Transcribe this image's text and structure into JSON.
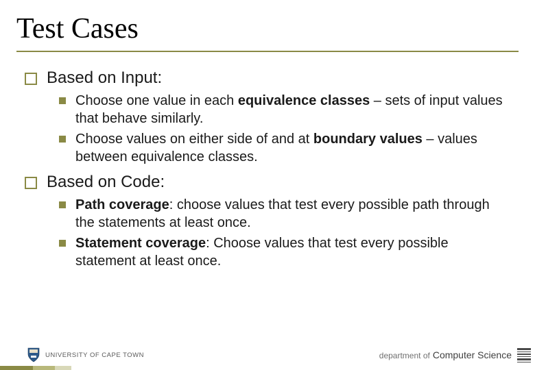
{
  "title": "Test Cases",
  "sections": [
    {
      "heading": "Based on Input:",
      "items": [
        {
          "pre": "Choose one value in each ",
          "bold": "equivalence classes",
          "post": " – sets of input values that behave similarly."
        },
        {
          "pre": "Choose values on either side of and at ",
          "bold": "boundary values",
          "post": " – values between equivalence classes."
        }
      ]
    },
    {
      "heading": "Based on Code:",
      "items": [
        {
          "boldlead": "Path coverage",
          "rest": ": choose values that test every possible path through the statements at least once."
        },
        {
          "boldlead": "Statement coverage",
          "rest": ": Choose values that test every possible statement at least once."
        }
      ]
    }
  ],
  "footer": {
    "university": "UNIVERSITY OF CAPE TOWN",
    "dept_prefix": "department of",
    "dept_name": "Computer Science",
    "stripe_colors": [
      "#8a8a45",
      "#b8b87a",
      "#d8d8b8"
    ],
    "stripe_widths": [
      48,
      32,
      24
    ]
  }
}
